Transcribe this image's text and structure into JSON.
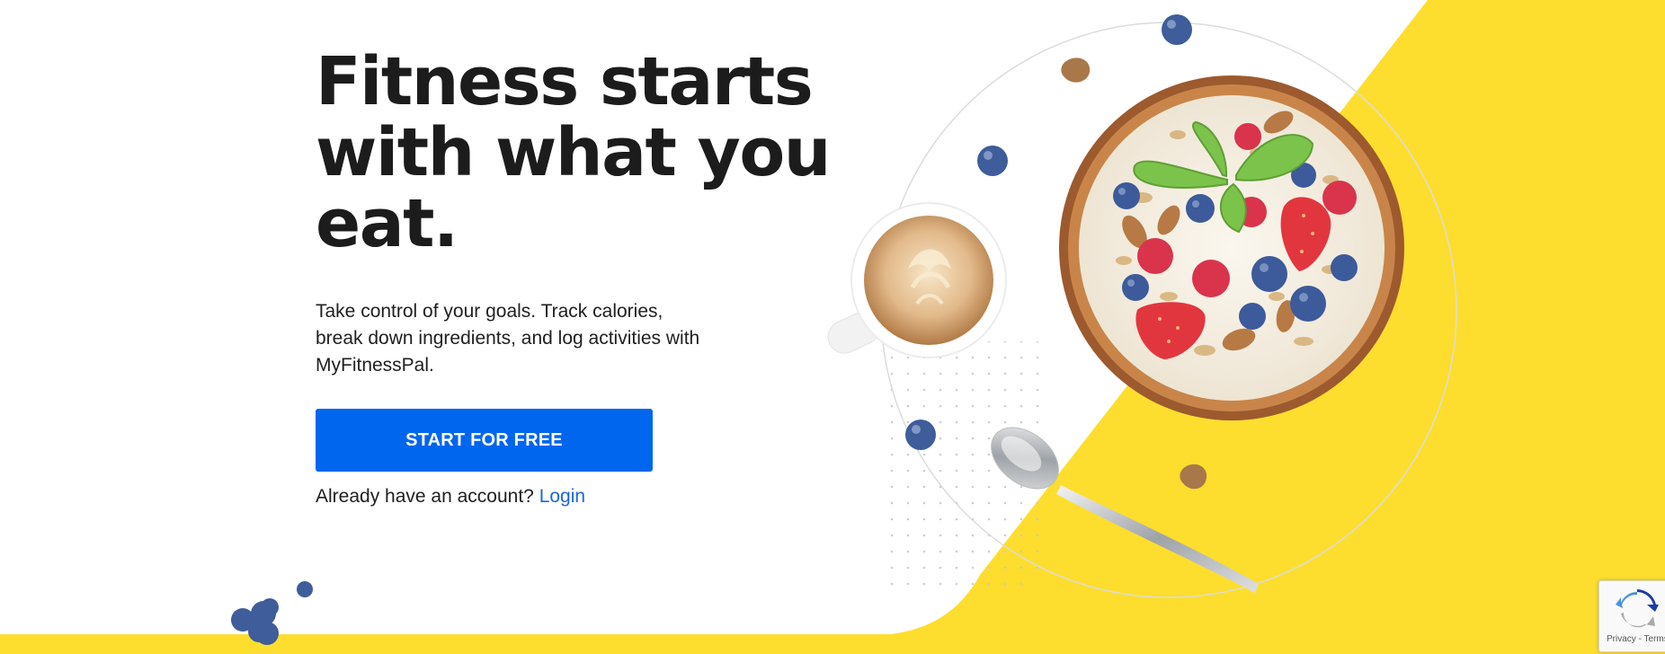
{
  "hero": {
    "title_line1": "Fitness starts",
    "title_line2": "with what you",
    "title_line3": "eat.",
    "subtitle": "Take control of your goals. Track calories, break down ingredients, and log activities with MyFitnessPal.",
    "cta_label": "START FOR FREE",
    "login_prompt": "Already have an account?",
    "login_link": "Login"
  },
  "recaptcha": {
    "privacy_label": "Privacy",
    "separator": " - ",
    "terms_label": "Terms"
  },
  "colors": {
    "accent_blue": "#0066ee",
    "link_blue": "#1a66e0",
    "brand_yellow": "#fdde2e",
    "heading_text": "#1c1c1c"
  },
  "icons": {
    "recaptcha": "recaptcha-icon"
  }
}
